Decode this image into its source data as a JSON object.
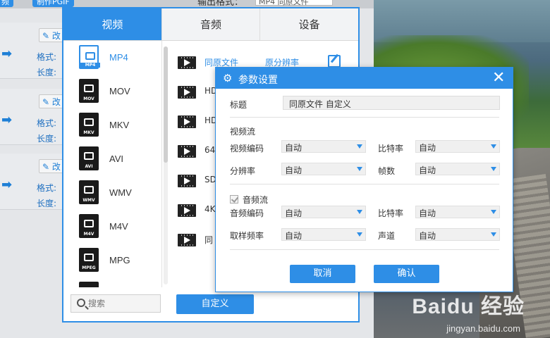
{
  "topbar": {
    "btn_left": "频",
    "btn_right": "制作PGIF",
    "output_format_label": "输出格式：",
    "output_format_value": "MP4 同原文件"
  },
  "tasks": [
    {
      "edit_label": "✎ 改",
      "format_label": "格式:",
      "length_label": "长度:"
    },
    {
      "edit_label": "✎ 改",
      "format_label": "格式:",
      "length_label": "长度:"
    },
    {
      "edit_label": "✎ 改",
      "format_label": "格式:",
      "length_label": "长度:"
    }
  ],
  "format_panel": {
    "tabs": [
      {
        "label": "视频",
        "active": true
      },
      {
        "label": "音频",
        "active": false
      },
      {
        "label": "设备",
        "active": false
      }
    ],
    "formats": [
      {
        "name": "MP4",
        "tag": "MP4",
        "selected": true
      },
      {
        "name": "MOV",
        "tag": "MOV",
        "selected": false
      },
      {
        "name": "MKV",
        "tag": "MKV",
        "selected": false
      },
      {
        "name": "AVI",
        "tag": "AVI",
        "selected": false
      },
      {
        "name": "WMV",
        "tag": "WMV",
        "selected": false
      },
      {
        "name": "M4V",
        "tag": "M4V",
        "selected": false
      },
      {
        "name": "MPG",
        "tag": "MPEG",
        "selected": false
      },
      {
        "name": "",
        "tag": "",
        "selected": false
      }
    ],
    "presets": [
      {
        "name": "同原文件",
        "res": "原分辨率",
        "selected": true
      },
      {
        "name": "HD",
        "res": "",
        "selected": false
      },
      {
        "name": "HD",
        "res": "",
        "selected": false
      },
      {
        "name": "64",
        "res": "",
        "selected": false
      },
      {
        "name": "SD",
        "res": "",
        "selected": false
      },
      {
        "name": "4K",
        "res": "",
        "selected": false
      },
      {
        "name": "同",
        "res": "",
        "selected": false
      }
    ],
    "search_placeholder": "搜索",
    "custom_button": "自定义"
  },
  "dialog": {
    "title": "参数设置",
    "close_glyph": "✕",
    "title_label": "标题",
    "title_value": "同原文件 自定义",
    "video_section": "视频流",
    "video_codec_label": "视频编码",
    "video_codec_value": "自动",
    "video_bitrate_label": "比特率",
    "video_bitrate_value": "自动",
    "resolution_label": "分辨率",
    "resolution_value": "自动",
    "framerate_label": "帧数",
    "framerate_value": "自动",
    "audio_section": "音频流",
    "audio_enabled": true,
    "audio_codec_label": "音频编码",
    "audio_codec_value": "自动",
    "audio_bitrate_label": "比特率",
    "audio_bitrate_value": "自动",
    "sample_rate_label": "取样频率",
    "sample_rate_value": "自动",
    "channel_label": "声道",
    "channel_value": "自动",
    "cancel_button": "取消",
    "ok_button": "确认"
  },
  "watermark": {
    "text": "Baidu 经验",
    "url": "jingyan.baidu.com"
  },
  "colors": {
    "accent": "#2e8ee6",
    "panel_bg": "#ffffff",
    "app_bg": "#e4e6e9"
  }
}
